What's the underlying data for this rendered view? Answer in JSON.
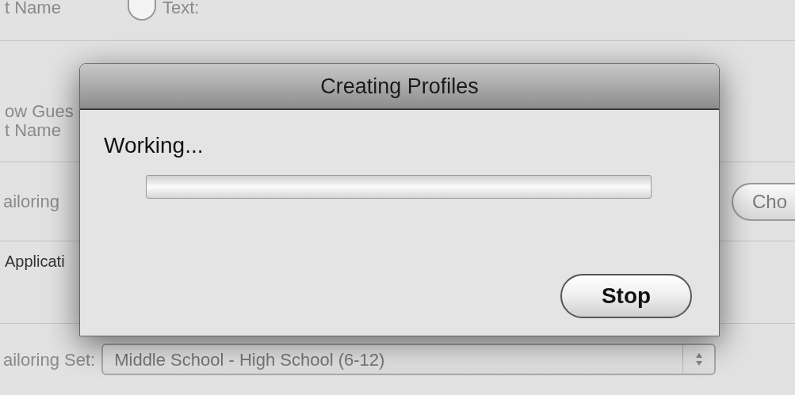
{
  "background": {
    "top_label": "t Name",
    "top_radio": {
      "label": "Text:",
      "selected": false
    },
    "guest_label": "ow Gues",
    "name_label": "t Name",
    "tailoring_label": "ailoring",
    "choose_button": "Cho",
    "application_label": "Applicati",
    "tailoring_set_label": "ailoring Set:",
    "tailoring_set_value": "Middle School - High School (6-12)"
  },
  "dialog": {
    "title": "Creating Profiles",
    "message": "Working...",
    "progress": {
      "level": 0
    },
    "buttons": [
      "Stop"
    ]
  }
}
